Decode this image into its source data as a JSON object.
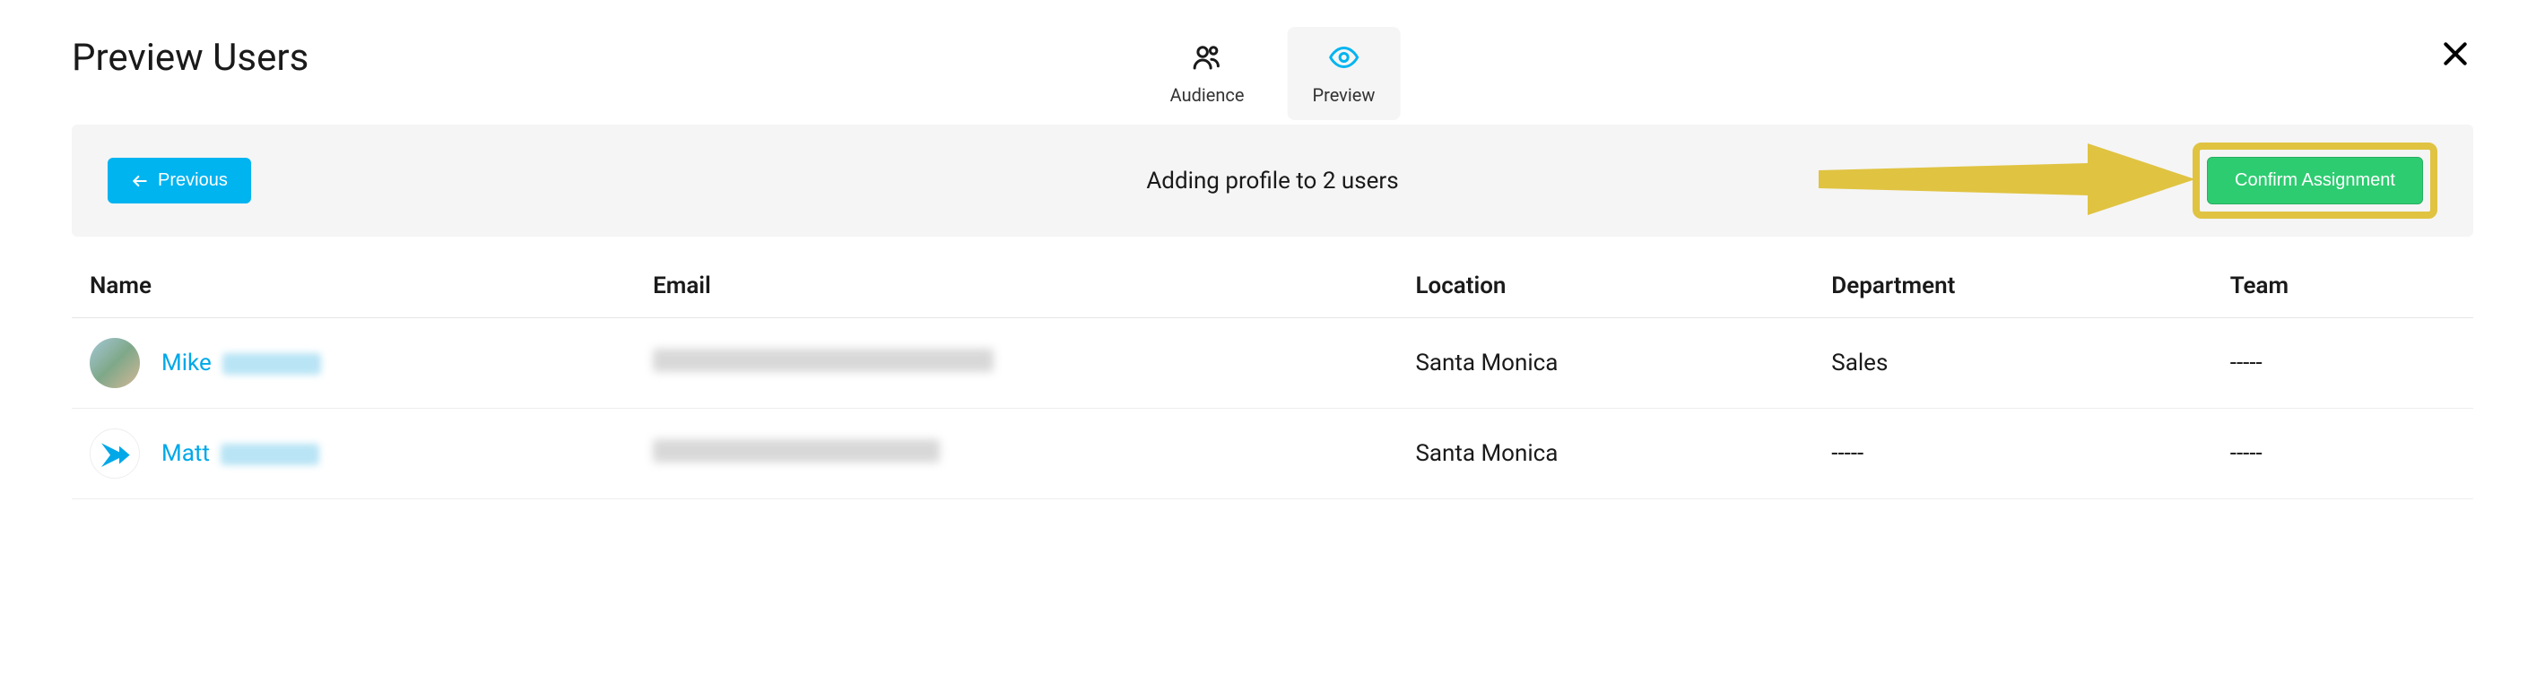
{
  "page": {
    "title": "Preview Users"
  },
  "tabs": {
    "audience": {
      "label": "Audience"
    },
    "preview": {
      "label": "Preview"
    }
  },
  "action_bar": {
    "previous_label": "Previous",
    "status": "Adding profile to 2 users",
    "confirm_label": "Confirm Assignment"
  },
  "table": {
    "headers": {
      "name": "Name",
      "email": "Email",
      "location": "Location",
      "department": "Department",
      "team": "Team"
    },
    "rows": [
      {
        "first_name": "Mike",
        "location": "Santa Monica",
        "department": "Sales",
        "team": "-----"
      },
      {
        "first_name": "Matt",
        "location": "Santa Monica",
        "department": "-----",
        "team": "-----"
      }
    ]
  }
}
